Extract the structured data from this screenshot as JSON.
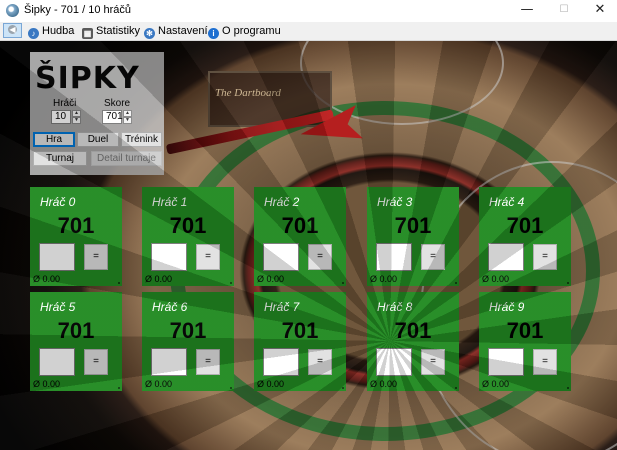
{
  "window": {
    "title": "Šipky - 701 / 10 hráčů",
    "minimize": "—",
    "maximize": "☐",
    "close": "✕"
  },
  "menu": {
    "back_icon": "back-arrow-icon",
    "items": [
      {
        "label": "Hudba",
        "icon": "music-icon",
        "color": "#3a78c2"
      },
      {
        "label": "Statistiky",
        "icon": "stats-icon",
        "color": "#555555"
      },
      {
        "label": "Nastavení",
        "icon": "gear-icon",
        "color": "#3a78c2"
      },
      {
        "label": "O programu",
        "icon": "info-icon",
        "color": "#1e6fd0"
      }
    ]
  },
  "background": {
    "sign_text": "The Dartboard"
  },
  "panel": {
    "logo": "ŠIPKY",
    "players_label": "Hráči",
    "players_value": "10",
    "score_label": "Skore",
    "score_value": "701",
    "buttons": {
      "hra": "Hra",
      "duel": "Duel",
      "trenink": "Trénink",
      "turnaj": "Turnaj",
      "detail": "Detail turnaje"
    }
  },
  "eq_label": "=",
  "players": [
    {
      "name": "Hráč 0",
      "score": "701",
      "avg": "Ø 0.00"
    },
    {
      "name": "Hráč 1",
      "score": "701",
      "avg": "Ø 0.00"
    },
    {
      "name": "Hráč 2",
      "score": "701",
      "avg": "Ø 0.00"
    },
    {
      "name": "Hráč 3",
      "score": "701",
      "avg": "Ø 0.00"
    },
    {
      "name": "Hráč 4",
      "score": "701",
      "avg": "Ø 0.00"
    },
    {
      "name": "Hráč 5",
      "score": "701",
      "avg": "Ø 0.00"
    },
    {
      "name": "Hráč 6",
      "score": "701",
      "avg": "Ø 0.00"
    },
    {
      "name": "Hráč 7",
      "score": "701",
      "avg": "Ø 0.00"
    },
    {
      "name": "Hráč 8",
      "score": "701",
      "avg": "Ø 0.00"
    },
    {
      "name": "Hráč 9",
      "score": "701",
      "avg": "Ø 0.00"
    }
  ],
  "colors": {
    "card": "#228b22",
    "accent": "#0078d7"
  }
}
